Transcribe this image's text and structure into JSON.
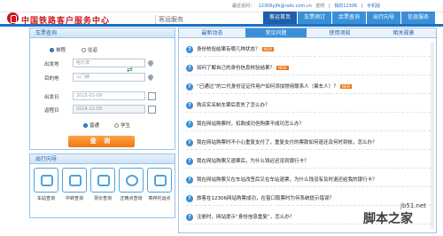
{
  "header": {
    "site_title": "中国铁路客户服务中心",
    "subtitle": "客运服务",
    "user_info": [
      "最近访问：",
      "12306yjfk@rails.com.cn",
      "定时",
      "|",
      "我的12306",
      "|",
      "手机版"
    ]
  },
  "nav": {
    "items": [
      "客运首页",
      "车票预订",
      "余票查询",
      "出行向导",
      "信息服务"
    ],
    "active_index": 0
  },
  "ticket_panel": {
    "title": "车票查询",
    "trip_types": [
      "单程",
      "往返"
    ],
    "from_label": "出发地",
    "from_value": "哈尔滨",
    "to_label": "目的地",
    "to_value": "三门峡",
    "depart_label": "出发日",
    "depart_value": "2015-01-09",
    "return_label": "返程日",
    "return_value": "2014-12-09",
    "passenger_types": [
      "普通",
      "学生"
    ],
    "search_button": "查 询"
  },
  "guide_panel": {
    "title": "出行向导",
    "items": [
      {
        "label": "车站查询",
        "icon": "station-icon"
      },
      {
        "label": "中转查询",
        "icon": "transfer-icon"
      },
      {
        "label": "票价查询",
        "icon": "fare-icon"
      },
      {
        "label": "正晚点查询",
        "icon": "clock-icon"
      },
      {
        "label": "寄存托运点",
        "icon": "luggage-icon"
      }
    ]
  },
  "main_panel": {
    "tabs": [
      "最新动态",
      "常见问题",
      "使用须知",
      "相关规章"
    ],
    "active_tab": 1,
    "questions": [
      {
        "text": "身份核验结果有哪几种状态？",
        "badge": "NEW"
      },
      {
        "text": "如何了解自己的身份信息核验结果？",
        "badge": "NEW"
      },
      {
        "text": "“已通过”的二代身份证证件用户如何添加常用联系人（乘车人）？",
        "badge": "NEW"
      },
      {
        "text": "购买实名制车票后丢失了怎么办？",
        "badge": ""
      },
      {
        "text": "我在网站购票时，扣款成功但购票不成功怎么办？",
        "badge": ""
      },
      {
        "text": "我在网站购票时不小心重复支付了，重复支付的票款如何退还及何时到帐，怎么办？",
        "badge": ""
      },
      {
        "text": "我在网站购票又退票后，为什么钱迟迟没到银行卡？",
        "badge": ""
      },
      {
        "text": "我在网站购票又在车站改签后又在车站退票，为什么钱没有及时退还给我的银行卡？",
        "badge": ""
      },
      {
        "text": "旅客在12306网站购票成功，在窗口取票时为何系统提示错误？",
        "badge": ""
      },
      {
        "text": "注册时，网站提示“身份信息重复”，怎么办？",
        "badge": ""
      }
    ]
  },
  "watermark": {
    "text": "脚本之家",
    "url": "jb51.net"
  },
  "colors": {
    "brand_red": "#c8161d",
    "nav_blue": "#3a8fd6",
    "accent_orange": "#f07610"
  }
}
